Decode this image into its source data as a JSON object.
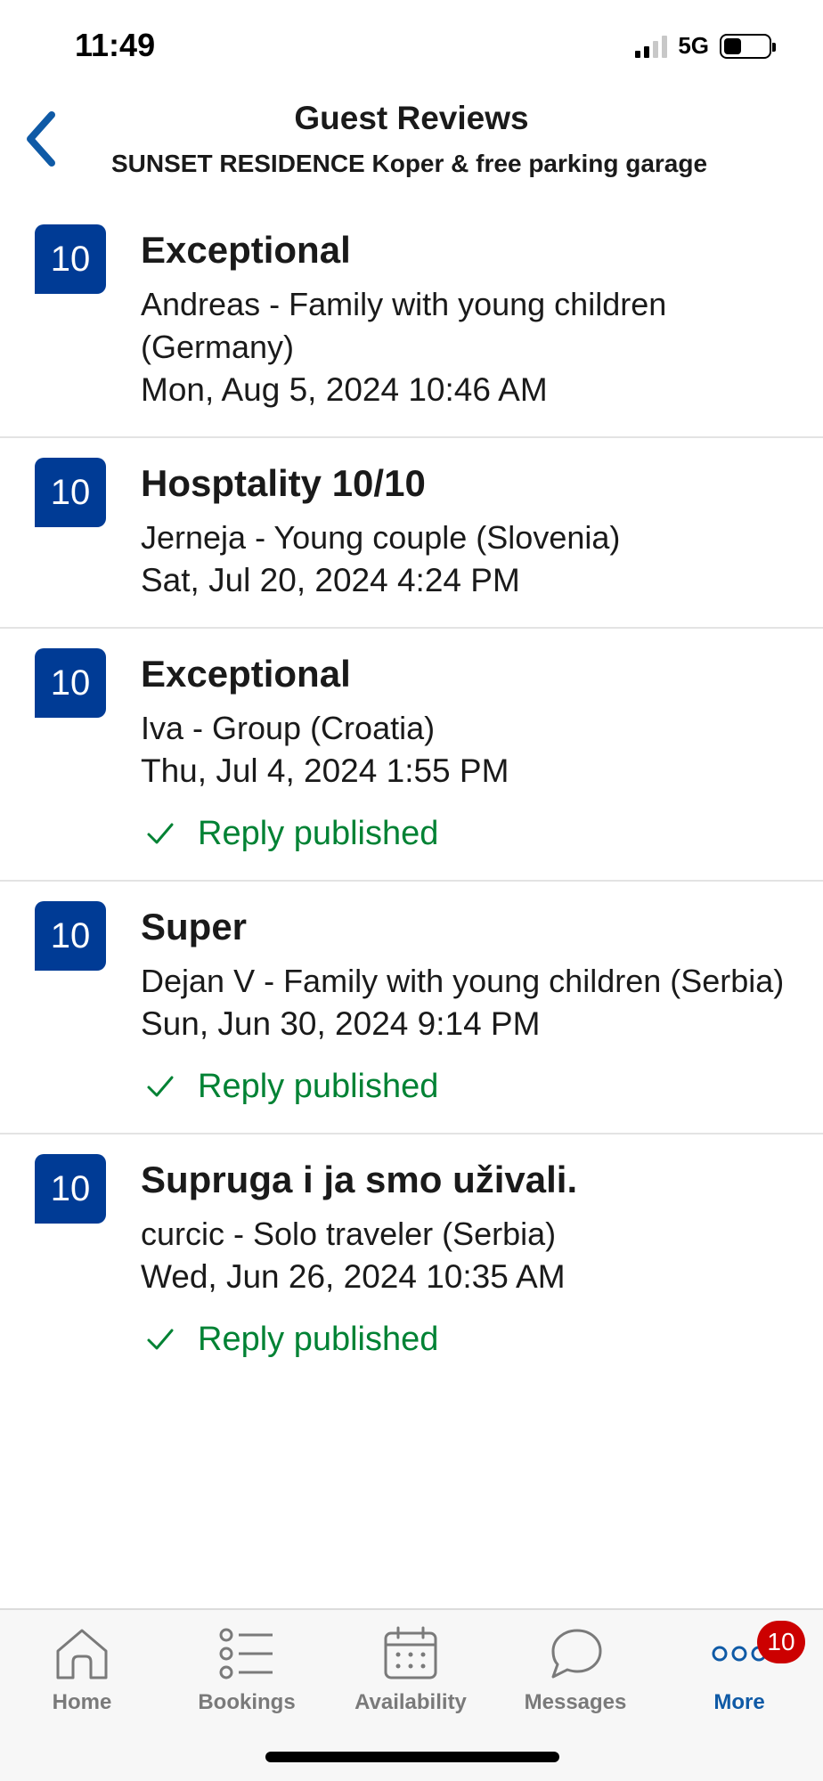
{
  "status_bar": {
    "time": "11:49",
    "network": "5G",
    "battery_level": 0.4
  },
  "header": {
    "title": "Guest Reviews",
    "subtitle": "SUNSET RESIDENCE Koper & free parking garage"
  },
  "reviews": [
    {
      "score": "10",
      "title": "Exceptional",
      "guest": "Andreas - Family with young children (Germany)",
      "date": "Mon, Aug 5, 2024 10:46 AM",
      "reply": ""
    },
    {
      "score": "10",
      "title": "Hosptality 10/10",
      "guest": "Jerneja - Young couple (Slovenia)",
      "date": "Sat, Jul 20, 2024 4:24 PM",
      "reply": ""
    },
    {
      "score": "10",
      "title": "Exceptional",
      "guest": "Iva - Group (Croatia)",
      "date": "Thu, Jul 4, 2024 1:55 PM",
      "reply": "Reply published"
    },
    {
      "score": "10",
      "title": "Super",
      "guest": "Dejan V - Family with young children (Serbia)",
      "date": "Sun, Jun 30, 2024 9:14 PM",
      "reply": "Reply published"
    },
    {
      "score": "10",
      "title": "Supruga i ja smo uživali.",
      "guest": "curcic - Solo traveler (Serbia)",
      "date": "Wed, Jun 26, 2024 10:35 AM",
      "reply": "Reply published"
    }
  ],
  "tab_bar": {
    "tabs": [
      {
        "label": "Home",
        "icon": "home-icon"
      },
      {
        "label": "Bookings",
        "icon": "list-icon"
      },
      {
        "label": "Availability",
        "icon": "calendar-icon"
      },
      {
        "label": "Messages",
        "icon": "chat-bubble-icon"
      },
      {
        "label": "More",
        "icon": "more-dots-icon",
        "badge": "10",
        "active": true
      }
    ]
  },
  "colors": {
    "score_badge": "#003b95",
    "reply_green": "#008234",
    "back_arrow": "#0f5aa6",
    "notification_badge": "#cc0000",
    "active_tab": "#0f5aa6",
    "inactive_tab": "#7a7a7a"
  }
}
